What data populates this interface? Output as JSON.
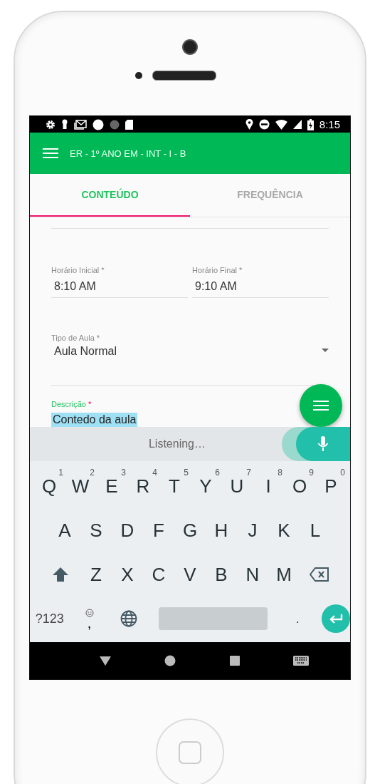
{
  "status_bar": {
    "time": "8:15"
  },
  "app_bar": {
    "title": "ER - 1º ANO EM - INT - I - B"
  },
  "tabs": [
    {
      "label": "CONTEÚDO",
      "selected": true
    },
    {
      "label": "FREQUÊNCIA",
      "selected": false
    }
  ],
  "time_fields": [
    {
      "label": "Horário Inicial",
      "required_mark": "*",
      "value": "8:10 AM"
    },
    {
      "label": "Horário Final",
      "required_mark": "*",
      "value": "9:10 AM"
    }
  ],
  "type_field": {
    "label": "Tipo de Aula",
    "required_mark": "*",
    "value": "Aula Normal"
  },
  "description_field": {
    "label": "Descrição",
    "required_mark": "*",
    "focused": true,
    "value": "Contedo da aula",
    "highlighted": true
  },
  "voice_bar": {
    "text": "Listening…"
  },
  "keyboard": {
    "rows": [
      [
        {
          "kind": "letter",
          "label": "Q",
          "hint": "1"
        },
        {
          "kind": "letter",
          "label": "W",
          "hint": "2"
        },
        {
          "kind": "letter",
          "label": "E",
          "hint": "3"
        },
        {
          "kind": "letter",
          "label": "R",
          "hint": "4"
        },
        {
          "kind": "letter",
          "label": "T",
          "hint": "5"
        },
        {
          "kind": "letter",
          "label": "Y",
          "hint": "6"
        },
        {
          "kind": "letter",
          "label": "U",
          "hint": "7"
        },
        {
          "kind": "letter",
          "label": "I",
          "hint": "8"
        },
        {
          "kind": "letter",
          "label": "O",
          "hint": "9"
        },
        {
          "kind": "letter",
          "label": "P",
          "hint": "0"
        }
      ],
      [
        {
          "kind": "letter",
          "label": "A"
        },
        {
          "kind": "letter",
          "label": "S"
        },
        {
          "kind": "letter",
          "label": "D"
        },
        {
          "kind": "letter",
          "label": "F"
        },
        {
          "kind": "letter",
          "label": "G"
        },
        {
          "kind": "letter",
          "label": "H"
        },
        {
          "kind": "letter",
          "label": "J"
        },
        {
          "kind": "letter",
          "label": "K"
        },
        {
          "kind": "letter",
          "label": "L"
        }
      ],
      [
        {
          "kind": "shift"
        },
        {
          "kind": "letter",
          "label": "Z"
        },
        {
          "kind": "letter",
          "label": "X"
        },
        {
          "kind": "letter",
          "label": "C"
        },
        {
          "kind": "letter",
          "label": "V"
        },
        {
          "kind": "letter",
          "label": "B"
        },
        {
          "kind": "letter",
          "label": "N"
        },
        {
          "kind": "letter",
          "label": "M"
        },
        {
          "kind": "backspace"
        }
      ],
      [
        {
          "kind": "symbols",
          "label": "?123"
        },
        {
          "kind": "comma",
          "label": ","
        },
        {
          "kind": "globe"
        },
        {
          "kind": "space"
        },
        {
          "kind": "period",
          "label": "."
        },
        {
          "kind": "enter"
        }
      ]
    ]
  }
}
